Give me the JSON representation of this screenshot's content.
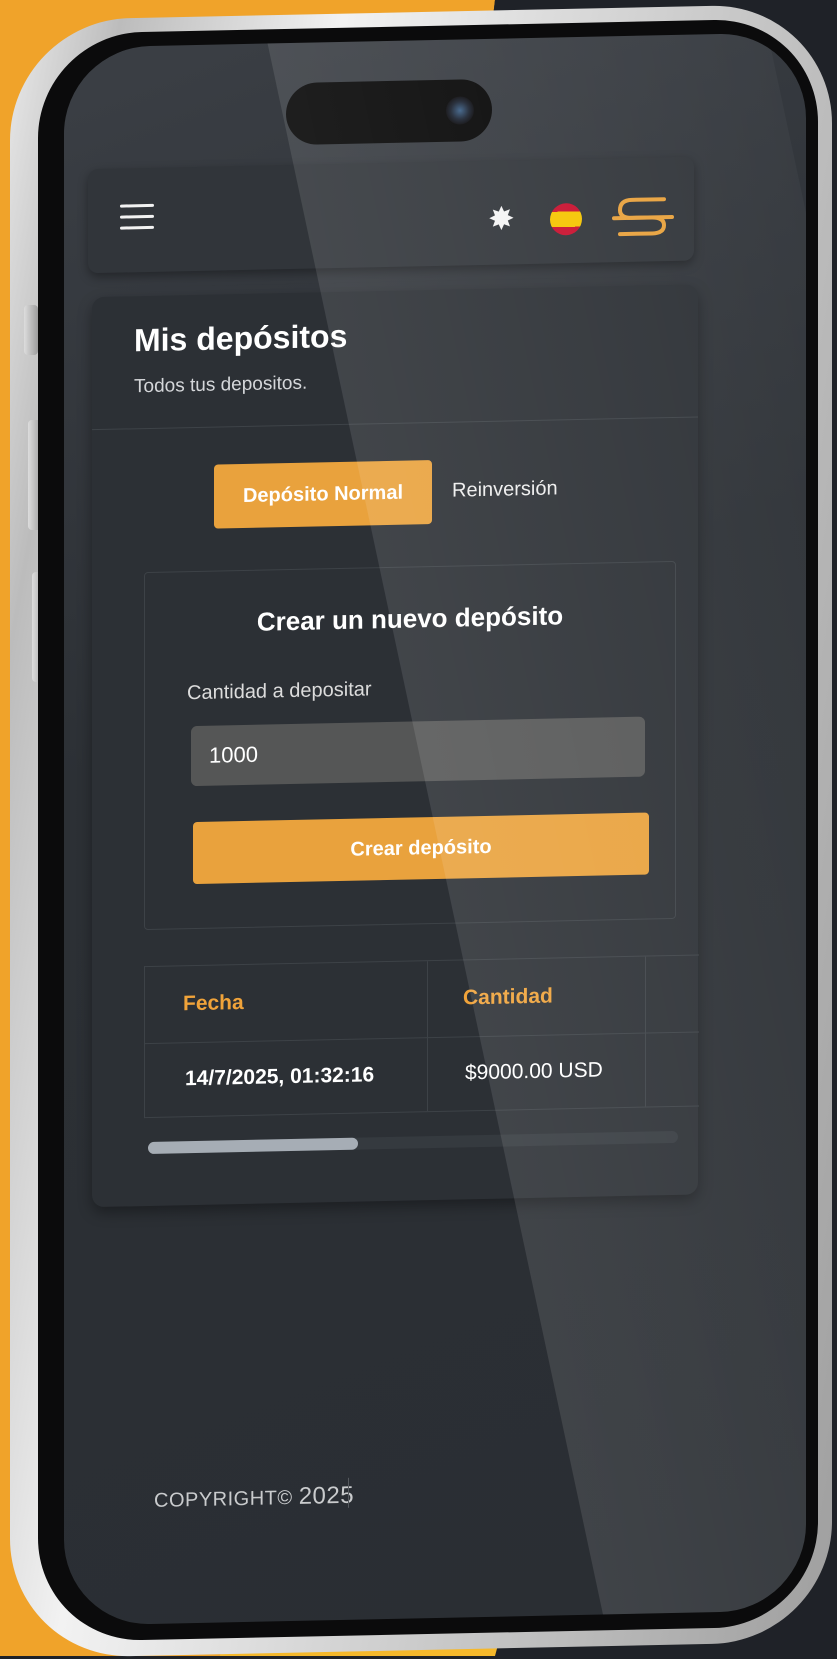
{
  "header": {
    "menu_icon": "hamburger-menu-icon",
    "theme_icon": "sun-icon",
    "language_icon": "spain-flag-icon",
    "logo_icon": "brand-s-logo-icon",
    "accent_color": "#e9a23d"
  },
  "page": {
    "title": "Mis depósitos",
    "subtitle": "Todos tus depositos."
  },
  "tabs": [
    {
      "label": "Depósito Normal",
      "active": true
    },
    {
      "label": "Reinversión",
      "active": false
    }
  ],
  "form": {
    "title": "Crear un nuevo depósito",
    "amount_label": "Cantidad a depositar",
    "amount_value": "1000",
    "submit_label": "Crear depósito"
  },
  "table": {
    "columns": [
      "Fecha",
      "Cantidad"
    ],
    "rows": [
      [
        "14/7/2025, 01:32:16",
        "$9000.00 USD"
      ]
    ]
  },
  "footer": {
    "copyright_label": "COPYRIGHT©",
    "year": "2025"
  }
}
